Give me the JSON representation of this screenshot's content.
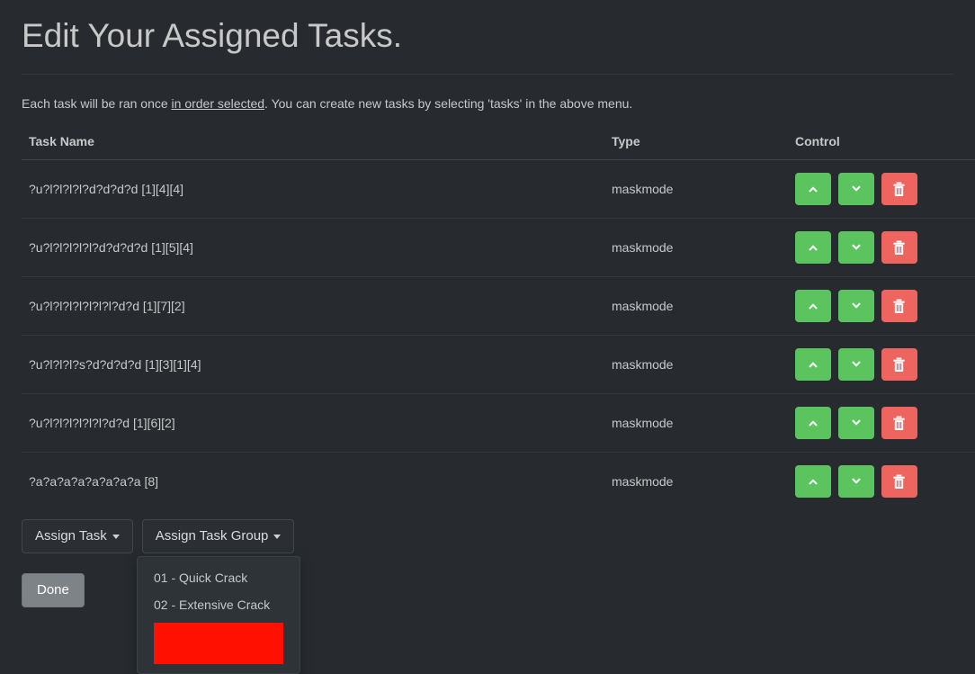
{
  "header": {
    "title": "Edit Your Assigned Tasks."
  },
  "intro": {
    "before": "Each task will be ran once ",
    "emphasis": "in order selected",
    "after": ". You can create new tasks by selecting 'tasks' in the above menu."
  },
  "table": {
    "columns": [
      "Task Name",
      "Type",
      "Control"
    ],
    "rows": [
      {
        "name": "?u?l?l?l?l?d?d?d?d [1][4][4]",
        "type": "maskmode"
      },
      {
        "name": "?u?l?l?l?l?l?d?d?d?d [1][5][4]",
        "type": "maskmode"
      },
      {
        "name": "?u?l?l?l?l?l?l?l?d?d [1][7][2]",
        "type": "maskmode"
      },
      {
        "name": "?u?l?l?l?s?d?d?d?d [1][3][1][4]",
        "type": "maskmode"
      },
      {
        "name": "?u?l?l?l?l?l?l?d?d [1][6][2]",
        "type": "maskmode"
      },
      {
        "name": "?a?a?a?a?a?a?a?a [8]",
        "type": "maskmode"
      }
    ],
    "controls": {
      "move_up": "move-up",
      "move_down": "move-down",
      "delete": "delete"
    }
  },
  "footer": {
    "assign_task_label": "Assign Task",
    "assign_task_group_label": "Assign Task Group",
    "done_label": "Done"
  },
  "dropdown": {
    "open": true,
    "items": [
      "01 - Quick Crack",
      "02 - Extensive Crack"
    ],
    "highlight_color": "#ff1000"
  },
  "colors": {
    "background": "#272b30",
    "text": "#c8c8c8",
    "green_button": "#5cc45e",
    "red_button": "#ee6560",
    "done_button": "#7e8388",
    "dropdown_bg": "#2e3338"
  }
}
